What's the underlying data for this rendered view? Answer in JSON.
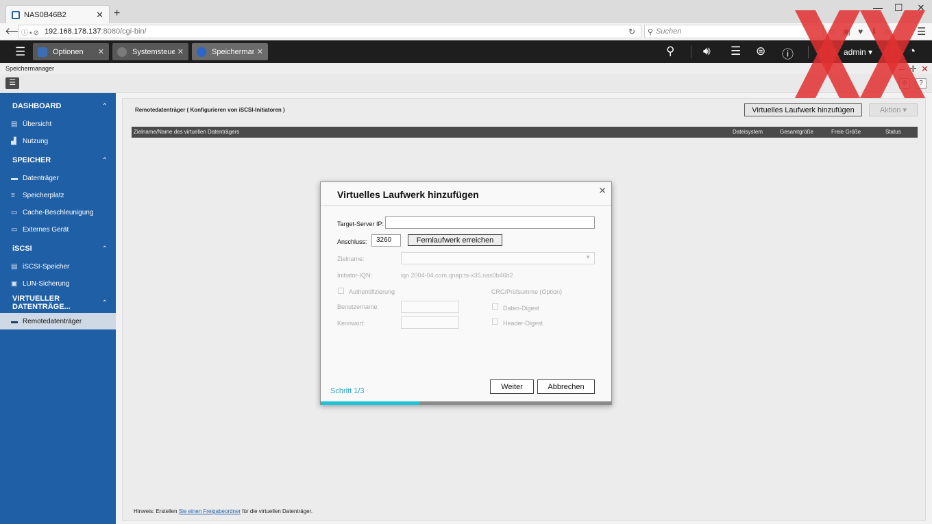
{
  "browser": {
    "tab_title": "NAS0B46B2",
    "url_host": "192.168.178.137",
    "url_path": ":8080/cgi-bin/",
    "search_placeholder": "Suchen"
  },
  "qts": {
    "tabs": [
      {
        "label": "Optionen",
        "icon_color": "#3a6fb8"
      },
      {
        "label": "Systemsteueru...",
        "icon_color": "#7a7a7a"
      },
      {
        "label": "Speichermana...",
        "icon_color": "#2a66c9"
      }
    ],
    "user": "admin ▾"
  },
  "app": {
    "title": "Speichermanager"
  },
  "sidebar": {
    "sections": [
      {
        "title": "DASHBOARD",
        "items": [
          {
            "label": "Übersicht",
            "icon": "overview-icon"
          },
          {
            "label": "Nutzung",
            "icon": "usage-icon"
          }
        ]
      },
      {
        "title": "SPEICHER",
        "items": [
          {
            "label": "Datenträger",
            "icon": "disk-icon"
          },
          {
            "label": "Speicherplatz",
            "icon": "storage-icon"
          },
          {
            "label": "Cache-Beschleunigung",
            "icon": "cache-icon"
          },
          {
            "label": "Externes Gerät",
            "icon": "external-device-icon"
          }
        ]
      },
      {
        "title": "iSCSI",
        "items": [
          {
            "label": "iSCSI-Speicher",
            "icon": "iscsi-icon"
          },
          {
            "label": "LUN-Sicherung",
            "icon": "lun-backup-icon"
          }
        ]
      },
      {
        "title": "VIRTUELLER DATENTRÄGE...",
        "items": [
          {
            "label": "Remotedatenträger",
            "icon": "remote-disk-icon"
          }
        ]
      }
    ]
  },
  "main": {
    "header": "Remotedatenträger ( Konfigurieren von iSCSI-Initiatoren )",
    "add_button": "Virtuelles Laufwerk hinzufügen",
    "action_button": "Aktion ▾",
    "columns": [
      "Zielname/Name des virtuellen Datenträgers",
      "Dateisystem",
      "Gesamtgröße",
      "Freie Größe",
      "Status"
    ],
    "hint_prefix": "Hinweis: Erstellen ",
    "hint_link": "Sie einen Freigabeordner",
    "hint_suffix": " für die virtuellen Datenträger."
  },
  "dialog": {
    "title": "Virtuelles Laufwerk hinzufügen",
    "target_ip_label": "Target-Server IP:",
    "target_ip_value": "",
    "port_label": "Anschluss:",
    "port_value": "3260",
    "reach_button": "Fernlaufwerk erreichen",
    "target_name_label": "Zielname:",
    "initiator_label": "Initiator-IQN:",
    "initiator_value": "iqn.2004-04.com.qnap:ts-x35.nas0b46b2",
    "auth_label": "Authentifizierung",
    "crc_label": "CRC/Prüfsumme (Option)",
    "username_label": "Benutzername:",
    "password_label": "Kennwort:",
    "data_digest_label": "Daten-Digest",
    "header_digest_label": "Header-Digest",
    "step": "Schritt 1/3",
    "next_button": "Weiter",
    "cancel_button": "Abbrechen",
    "progress": 0.34
  }
}
